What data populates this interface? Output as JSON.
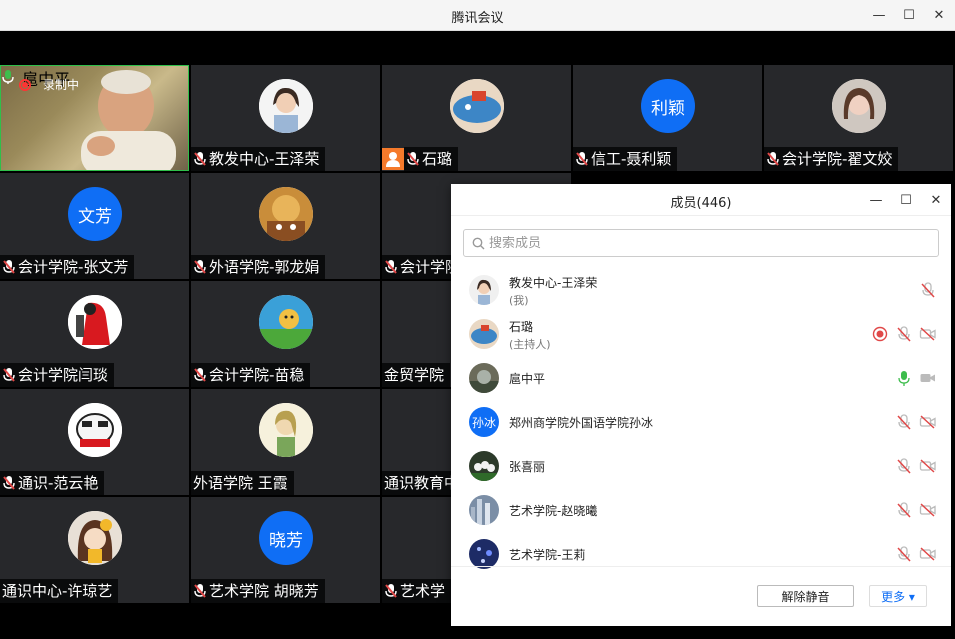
{
  "window": {
    "title": "腾讯会议"
  },
  "self_view": {
    "name": "扈中平",
    "recording_label": "录制中"
  },
  "tiles": [
    {
      "name": "教发中心-王泽荣",
      "avatar": "photo"
    },
    {
      "name": "石璐",
      "avatar": "whale"
    },
    {
      "name": "信工-聂利颖",
      "avatar_text": "利颖"
    },
    {
      "name": "会计学院-翟文姣",
      "avatar": "photo"
    },
    {
      "name": "会计学院-张文芳",
      "avatar_text": "文芳"
    },
    {
      "name": "外语学院-郭龙娟",
      "avatar": "photo"
    },
    {
      "name": "会计学院"
    },
    {
      "name": "会计学院闫琰",
      "avatar": "photo"
    },
    {
      "name": "会计学院-苗稳",
      "avatar": "photo"
    },
    {
      "name": "金贸学院"
    },
    {
      "name": "通识-范云艳",
      "avatar": "photo"
    },
    {
      "name": "外语学院 王霞",
      "avatar": "photo"
    },
    {
      "name": "通识教育中"
    },
    {
      "name": "通识中心-许琼艺",
      "avatar": "photo"
    },
    {
      "name": "艺术学院 胡晓芳",
      "avatar_text": "晓芳"
    },
    {
      "name": "艺术学"
    }
  ],
  "panel": {
    "title": "成员(446)",
    "search_placeholder": "搜索成员",
    "members": [
      {
        "name": "教发中心-王泽荣",
        "sub": "(我)"
      },
      {
        "name": "石璐",
        "sub": "(主持人)"
      },
      {
        "name": "扈中平"
      },
      {
        "name": "郑州商学院外国语学院孙冰",
        "avatar_text": "孙冰"
      },
      {
        "name": "张喜丽"
      },
      {
        "name": "艺术学院-赵晓曦"
      },
      {
        "name": "艺术学院-王莉"
      }
    ],
    "unmute_label": "解除静音",
    "more_label": "更多 ▾"
  },
  "colors": {
    "accent": "#0f6ef5",
    "mic_muted": "#e04848",
    "mic_active": "#3dbd4c",
    "host_badge": "#f57a2b"
  }
}
